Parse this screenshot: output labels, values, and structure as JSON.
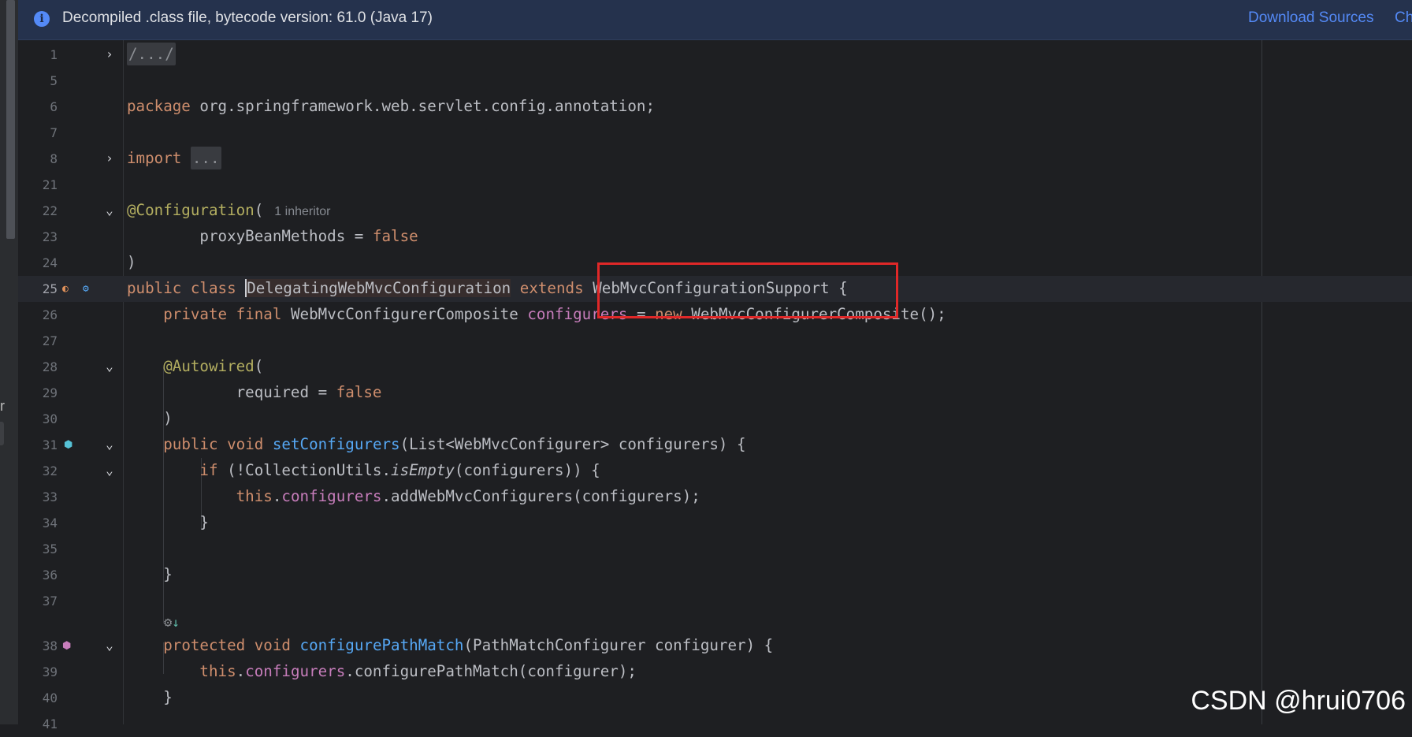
{
  "banner": {
    "message": "Decompiled .class file, bytecode version: 61.0 (Java 17)",
    "download_link": "Download Sources",
    "choose_link": "Ch"
  },
  "left_edge_text": "r",
  "lines": {
    "l1": "1",
    "l5": "5",
    "l6": "6",
    "l7": "7",
    "l8": "8",
    "l21": "21",
    "l22": "22",
    "l23": "23",
    "l24": "24",
    "l25": "25",
    "l26": "26",
    "l27": "27",
    "l28": "28",
    "l29": "29",
    "l30": "30",
    "l31": "31",
    "l32": "32",
    "l33": "33",
    "l34": "34",
    "l35": "35",
    "l36": "36",
    "l37": "37",
    "l38": "38",
    "l39": "39",
    "l40": "40",
    "l41": "41"
  },
  "code": {
    "folded_header": "/.../",
    "package_kw": "package",
    "package_name": " org.springframework.web.servlet.config.annotation;",
    "import_kw": "import",
    "import_folded": "...",
    "config_ann": "@Configuration",
    "config_paren": "(",
    "inheritor_hint": "1 inheritor",
    "proxy_name": "proxyBeanMethods = ",
    "false_kw": "false",
    "close_paren": ")",
    "public_kw": "public",
    "class_kw": "class",
    "class_name": "DelegatingWebMvcConfiguration",
    "extends_kw": "extends",
    "super_name": "WebMvcConfigurationSupport {",
    "private_kw": "private",
    "final_kw": "final",
    "composite_type": "WebMvcConfigurerComposite",
    "configurers_field": "configurers",
    "assign": " = ",
    "new_kw": "new",
    "composite_ctor": " WebMvcConfigurerComposite();",
    "autowired_ann": "@Autowired",
    "required_name": "required = ",
    "void_kw": "void",
    "set_method": "setConfigurers",
    "set_params": "(List<WebMvcConfigurer> configurers) {",
    "if_kw": "if",
    "if_cond_a": " (!CollectionUtils.",
    "is_empty": "isEmpty",
    "if_cond_b": "(configurers)) {",
    "this_kw": "this",
    "dot": ".",
    "add_call": ".addWebMvcConfigurers(configurers);",
    "close_brace": "}",
    "protected_kw": "protected",
    "cpm_method": "configurePathMatch",
    "cpm_params": "(PathMatchConfigurer configurer) {",
    "cpm_call": ".configurePathMatch(configurer);"
  },
  "icons": {
    "fold_closed": "chevron-right-icon",
    "fold_open": "chevron-down-icon",
    "override_arrow": "↓"
  },
  "watermark": "CSDN @hrui0706",
  "colors": {
    "keyword": "#cf8e6d",
    "annotation": "#b3ae60",
    "method": "#56a8f5",
    "field": "#c77dbb",
    "highlight_box": "#e02828",
    "banner_link": "#548af7"
  }
}
